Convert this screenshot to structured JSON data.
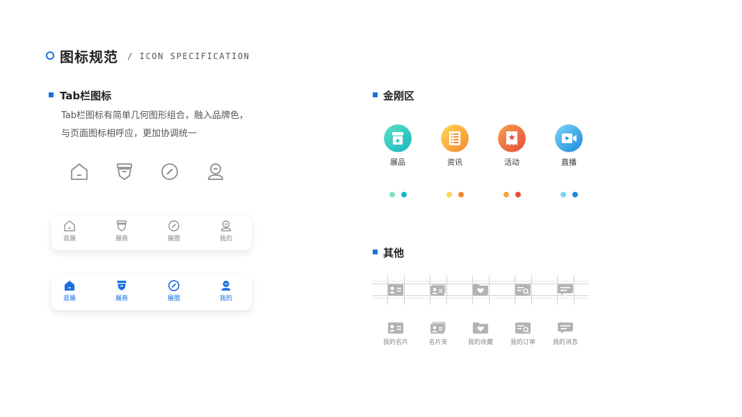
{
  "header": {
    "title_cn": "图标规范",
    "title_en": "/ ICON SPECIFICATION"
  },
  "tab_section": {
    "title": "Tab栏图标",
    "desc_line1": "Tab栏图标有简单几何图形组合，融入品牌色，",
    "desc_line2": "与页面图标相呼应，更加协调统一",
    "icons": [
      "home-icon",
      "exhibitor-icon",
      "compass-icon",
      "user-icon"
    ],
    "tabs": [
      "逛展",
      "展商",
      "展圈",
      "我的"
    ]
  },
  "kingkong_section": {
    "title": "金刚区",
    "items": [
      {
        "label": "展品",
        "icon": "box-icon",
        "colors": [
          "#5ee0c0",
          "#17b6c4"
        ]
      },
      {
        "label": "资讯",
        "icon": "list-icon",
        "colors": [
          "#ffd95a",
          "#f5892c"
        ]
      },
      {
        "label": "活动",
        "icon": "ticket-icon",
        "colors": [
          "#f6a24a",
          "#e84a3c"
        ]
      },
      {
        "label": "直播",
        "icon": "video-icon",
        "colors": [
          "#7ad6f6",
          "#1a8ae0"
        ]
      }
    ]
  },
  "other_section": {
    "title": "其他",
    "items": [
      {
        "label": "我的名片",
        "icon": "card-icon"
      },
      {
        "label": "名片夹",
        "icon": "card-holder-icon"
      },
      {
        "label": "我的收藏",
        "icon": "favorite-folder-icon"
      },
      {
        "label": "我的订单",
        "icon": "order-icon"
      },
      {
        "label": "我的消息",
        "icon": "message-icon"
      }
    ]
  },
  "colors": {
    "brand_blue": "#1a6fe0",
    "icon_gray": "#8a8a8a",
    "other_gray": "#b3b3b3"
  }
}
